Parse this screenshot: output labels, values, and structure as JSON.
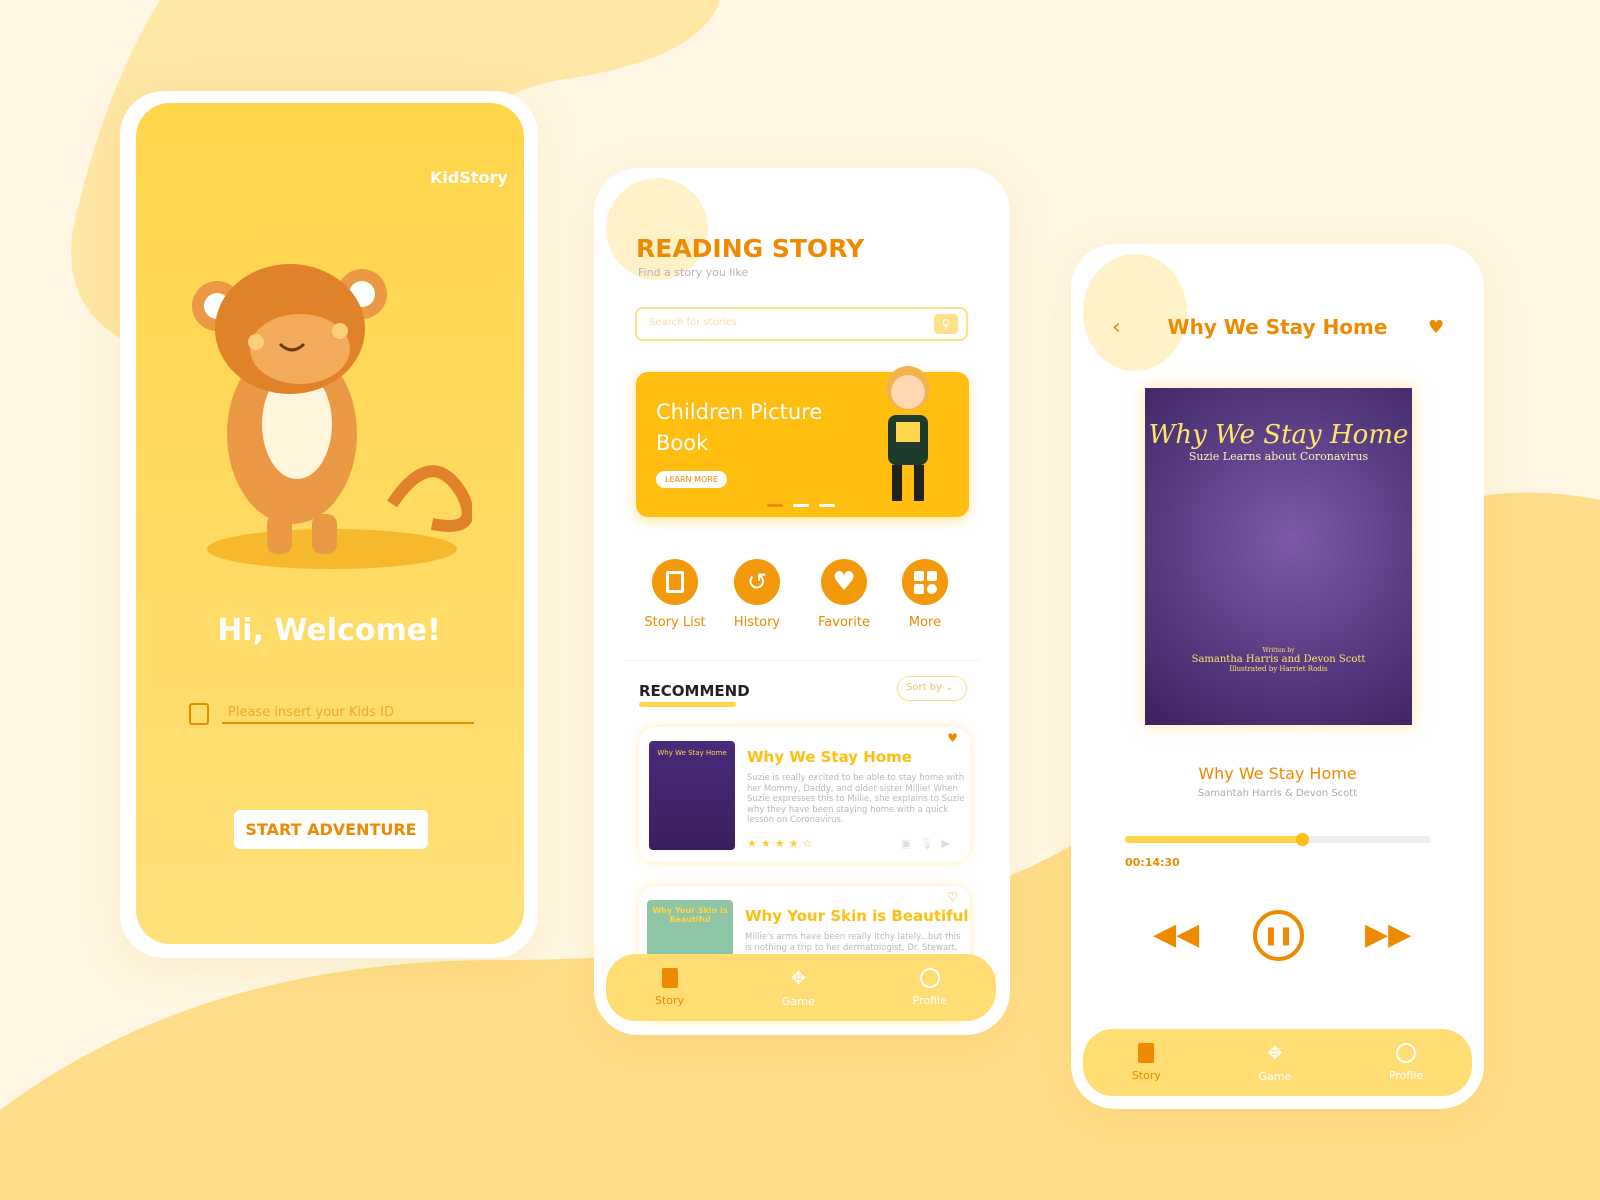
{
  "welcome": {
    "brand": "KidStory",
    "greeting": "Hi, Welcome!",
    "kids_id_placeholder": "Please insert your Kids ID",
    "start_button": "START ADVENTURE"
  },
  "reading": {
    "title": "READING STORY",
    "subtitle": "Find a story you like",
    "search_placeholder": "Search for stories",
    "banner": {
      "title": "Children Picture Book",
      "button": "LEARN MORE",
      "slides": 3,
      "active_slide": 1
    },
    "actions": [
      {
        "label": "Story List",
        "icon": "book-icon"
      },
      {
        "label": "History",
        "icon": "history-icon"
      },
      {
        "label": "Favorite",
        "icon": "heart-icon"
      },
      {
        "label": "More",
        "icon": "grid-icon"
      }
    ],
    "recommend_label": "RECOMMEND",
    "sort_label": "Sort by",
    "books": [
      {
        "title": "Why We Stay Home",
        "description": "Suzie is really excited to be able to stay home with her Mommy, Daddy, and older sister Millie! When Suzie expresses this to Millie, she explains to Suzie why they have been staying home with a quick lesson on Coronavirus.",
        "rating": 4.5,
        "favorite": true,
        "cover_title": "Why We Stay Home"
      },
      {
        "title": "Why Your Skin is Beautiful",
        "description": "Millie's arms have been really itchy lately...but this is nothing a trip to her dermatologist, Dr. Stewart,",
        "favorite": false,
        "cover_title": "Why Your Skin is Beautiful"
      }
    ]
  },
  "nav": {
    "items": [
      "Story",
      "Game",
      "Profile"
    ]
  },
  "player": {
    "header_title": "Why We Stay Home",
    "cover": {
      "title": "Why We Stay Home",
      "subtitle": "Suzie Learns about Coronavirus",
      "written_by": "Written by",
      "authors": "Samantha Harris and Devon Scott",
      "illustrated": "Illustrated by Harriet Rodis"
    },
    "title": "Why We Stay Home",
    "authors": "Samantah Harris & Devon Scott",
    "elapsed": "00:14:30",
    "progress": 0.58
  },
  "colors": {
    "accent": "#ee8a00",
    "yellow": "#ffbe10",
    "bg": "#fff7e3"
  }
}
